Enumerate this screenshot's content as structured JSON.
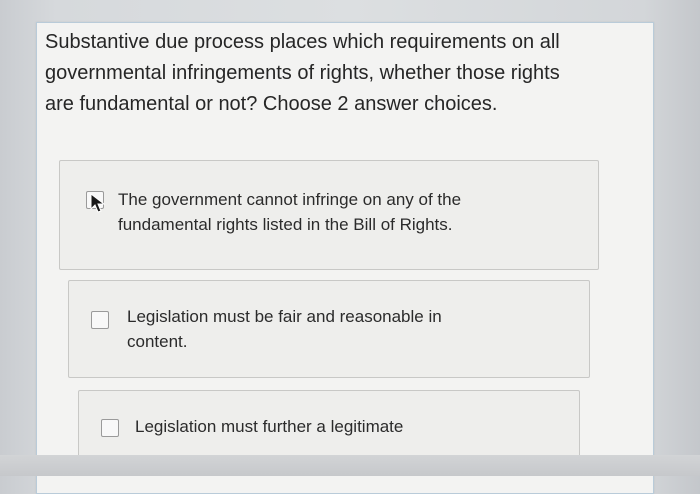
{
  "question": {
    "line1": "Substantive due process places which requirements on all",
    "line2": "governmental infringements of rights, whether those rights",
    "line3": "are fundamental or not? Choose 2 answer choices."
  },
  "options": [
    {
      "line1": "The government cannot infringe on any of the",
      "line2": "fundamental rights listed in the Bill of Rights.",
      "checked": false
    },
    {
      "line1": "Legislation must be fair and reasonable in",
      "line2": "content.",
      "checked": false
    },
    {
      "line1": "Legislation must further a legitimate",
      "line2": "",
      "checked": false
    }
  ],
  "colors": {
    "card_border": "#b9cbd9",
    "text": "#262626"
  },
  "icons": {
    "cursor": "mouse-pointer-icon",
    "checkbox": "checkbox-icon"
  }
}
